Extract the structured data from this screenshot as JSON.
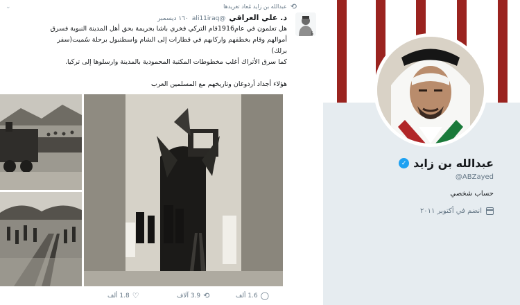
{
  "tweet": {
    "retweet_by": "عبدالله بن زايد مُعاد تغريدها",
    "author_name": "د. علي العراقي",
    "author_handle": "@ali11iraq",
    "date": "١٦٠ ديسمبر",
    "lines": [
      "هل تعلمون في عام1916قام التركي فخري باشا بجريمة بحق أهل المدينة النبوية فسرق",
      "أموالهم وقام بخطفهم واركابهم في قطارات إلى الشام واسطنبول برحلة سُميت(سفر",
      "برلك)",
      "كما سرق الأتراك أغلب مخطوطات المكتبة المحمودية بالمدينة وارسلوها إلى تركيا."
    ],
    "closing": "هؤلاء أجداد أردوغان وتاريخهم مع المسلمين العرب",
    "actions": {
      "replies": "1.6 ألف",
      "retweets": "3.9 آلاف",
      "likes": "1.8 ألف"
    },
    "icons": {
      "retweet": "retweet-icon",
      "reply": "reply-icon",
      "like": "heart-icon",
      "more": "chevron-down-icon"
    }
  },
  "profile": {
    "name": "عبدالله بن زايد",
    "handle": "@ABZayed",
    "bio": "حساب شخصي",
    "joined": "انضم في أكتوبر ٢٠١١",
    "verified_icon": "verified-badge-icon",
    "calendar_icon": "calendar-icon"
  },
  "colors": {
    "accent": "#1da1f2",
    "banner_stripe": "#9a231f",
    "muted_text": "#657786",
    "page_bg": "#e6ecf0"
  }
}
